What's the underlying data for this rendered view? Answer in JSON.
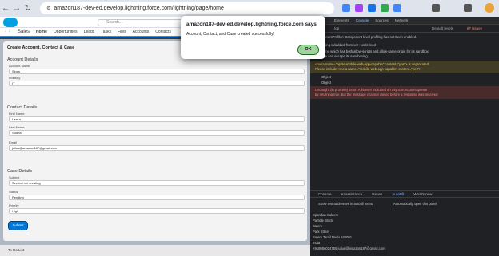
{
  "browser": {
    "url": "amazon187-dev-ed.develop.lightning.force.com/lightning/page/home"
  },
  "salesforce": {
    "app_name": "Sales",
    "search_placeholder": "Search...",
    "nav_items": [
      "Home",
      "Opportunities",
      "Leads",
      "Tasks",
      "Files",
      "Accounts",
      "Contacts"
    ],
    "form_title": "Create Account, Contact & Case",
    "account_section": "Account Details",
    "account_name_label": "Account Name",
    "account_name_value": "Sinas",
    "industry_label": "Industry",
    "industry_value": "IT",
    "contact_section": "Contact Details",
    "first_name_label": "First Name",
    "first_name_value": "Laasa",
    "last_name_label": "Last Name",
    "last_name_value": "Sudha",
    "email_label": "Email",
    "email_value": "julius@amazon187@gmail.com",
    "case_section": "Case Details",
    "subject_label": "Subject",
    "subject_value": "Second net creating",
    "status_label": "Status",
    "status_value": "Pending",
    "priority_label": "Priority",
    "priority_value": "High",
    "submit_label": "Submit",
    "utility_label": "To Do List"
  },
  "dialog": {
    "title": "amazon187-dev-ed.develop.lightning.force.com says",
    "message": "Account, Contact, and Case created successfully!",
    "ok_label": "OK"
  },
  "devtools": {
    "tabs": [
      "Elements",
      "Console",
      "Sources",
      "Network"
    ],
    "top_context": "top",
    "levels": "Default levels",
    "issues": "67 issues",
    "console_lines": [
      "ComponentProfiler: Component level profiling has not been enabled.",
      "api setting initialized from ver : undefined",
      "An iframe which has both allow-scripts and allow-same-origin for its sandbox",
      "attribute can escape its sandboxing.",
      "<meta name=\"apple-mobile-web-app-capable\" content=\"yes\"> is deprecated.",
      "Please include <meta name=\"mobile-web-app-capable\" content=\"yes\">",
      "Object",
      "Object",
      "Uncaught (in promise) Error: A listener indicated an asynchronous response",
      "by returning true, but the message channel closed before a response was received"
    ],
    "drawer_tabs": [
      "Console",
      "AI assistance",
      "Issues",
      "AutoFill",
      "What's new"
    ],
    "show_test": "Show test addresses in autofill menu",
    "auto_open": "Automatically open this panel",
    "autofill_lines": [
      "Spandan Saleem",
      "Particle Block",
      "Salem",
      "Park Street",
      "Salem Tamil Nadu 636001",
      "India",
      "+918056024755  julius@amazon187@gmail.com"
    ]
  }
}
